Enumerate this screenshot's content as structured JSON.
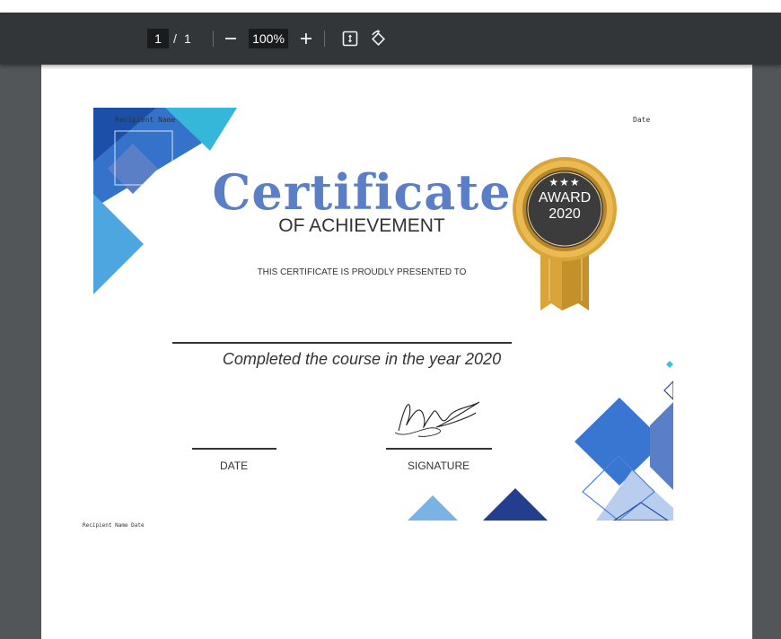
{
  "toolbar": {
    "current_page": "1",
    "page_separator": "/",
    "total_pages": "1",
    "zoom_out_icon": "minus-icon",
    "zoom_level": "100%",
    "zoom_in_icon": "plus-icon",
    "fit_page_icon": "fit-to-page-icon",
    "rotate_icon": "rotate-counterclockwise-icon"
  },
  "form_fields": {
    "recipient_name": "Recipient Name",
    "date": "Date",
    "footer_text": "Recipient Name Date"
  },
  "certificate": {
    "title": "Certificate",
    "subtitle": "OF ACHIEVEMENT",
    "presented_to": "THIS CERTIFICATE IS PROUDLY PRESENTED TO",
    "course_text": "Completed the course in the year 2020",
    "date_label": "DATE",
    "signature_label": "SIGNATURE",
    "badge": {
      "stars": "★★★",
      "line1": "AWARD",
      "line2": "2020"
    }
  },
  "colors": {
    "toolbar_bg": "#323639",
    "viewer_bg": "#525659",
    "title_blue": "#5b7fc7",
    "accent_blue": "#2e6fd0",
    "gold": "#d9a53a"
  }
}
